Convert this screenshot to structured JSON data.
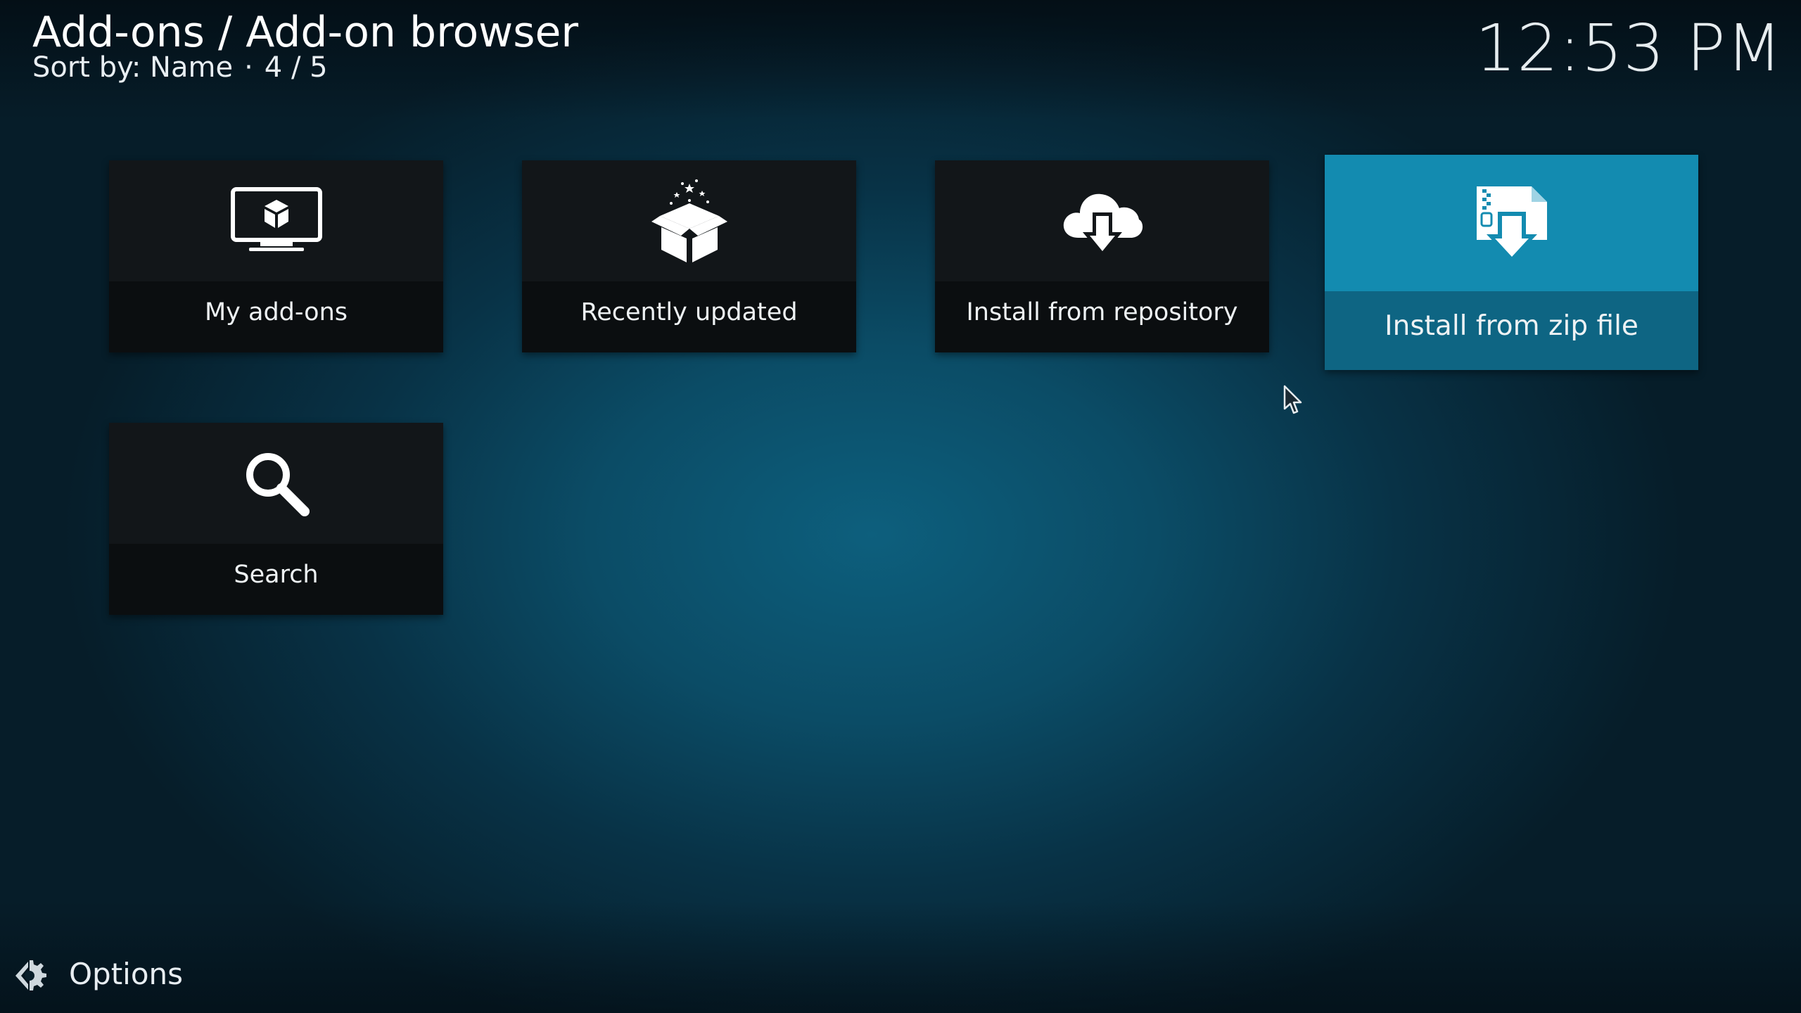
{
  "header": {
    "title": "Add-ons / Add-on browser",
    "sort_label": "Sort by: Name",
    "separator": "·",
    "position": "4 / 5"
  },
  "clock": {
    "time": "12:53 PM"
  },
  "tiles": [
    {
      "label": "My add-ons",
      "icon": "monitor-addon-icon"
    },
    {
      "label": "Recently updated",
      "icon": "open-box-icon"
    },
    {
      "label": "Install from repository",
      "icon": "cloud-download-icon"
    },
    {
      "label": "Install from zip file",
      "icon": "zip-file-download-icon",
      "focused": true
    },
    {
      "label": "Search",
      "icon": "search-icon"
    }
  ],
  "footer": {
    "options_label": "Options",
    "options_icon": "options-gear-icon"
  },
  "colors": {
    "focus_tile": "#138bb0",
    "focus_label_bar": "#0e6583",
    "tile": "#121619",
    "background_center": "#0d5f7d"
  }
}
